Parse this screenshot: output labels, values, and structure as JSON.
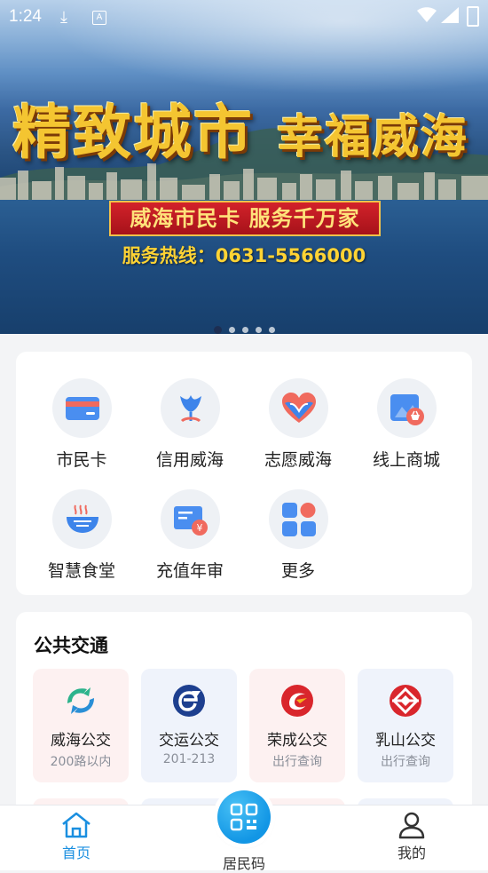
{
  "status_bar": {
    "time": "1:24",
    "download_icon": "download-icon",
    "app_icon": "A"
  },
  "banner": {
    "slogan_left": "精致城市",
    "slogan_right": "幸福威海",
    "ribbon": "威海市民卡 服务千万家",
    "hotline": "服务热线：0631-5566000",
    "slide_count": 5,
    "active_slide": 1
  },
  "services": [
    {
      "label": "市民卡",
      "icon": "card-icon"
    },
    {
      "label": "信用威海",
      "icon": "credit-flower-icon"
    },
    {
      "label": "志愿威海",
      "icon": "heart-icon"
    },
    {
      "label": "线上商城",
      "icon": "shop-icon"
    },
    {
      "label": "智慧食堂",
      "icon": "bowl-icon"
    },
    {
      "label": "充值年审",
      "icon": "recharge-icon"
    },
    {
      "label": "更多",
      "icon": "grid-icon"
    }
  ],
  "transit": {
    "title": "公共交通",
    "items": [
      {
        "name": "威海公交",
        "sub": "200路以内"
      },
      {
        "name": "交运公交",
        "sub": "201-213"
      },
      {
        "name": "荣成公交",
        "sub": "出行查询"
      },
      {
        "name": "乳山公交",
        "sub": "出行查询"
      }
    ]
  },
  "bottom_nav": {
    "home": "首页",
    "code": "居民码",
    "me": "我的"
  },
  "colors": {
    "accent": "#1a8fe0",
    "card_bg": "#ffffff",
    "page_bg": "#f3f4f6"
  }
}
